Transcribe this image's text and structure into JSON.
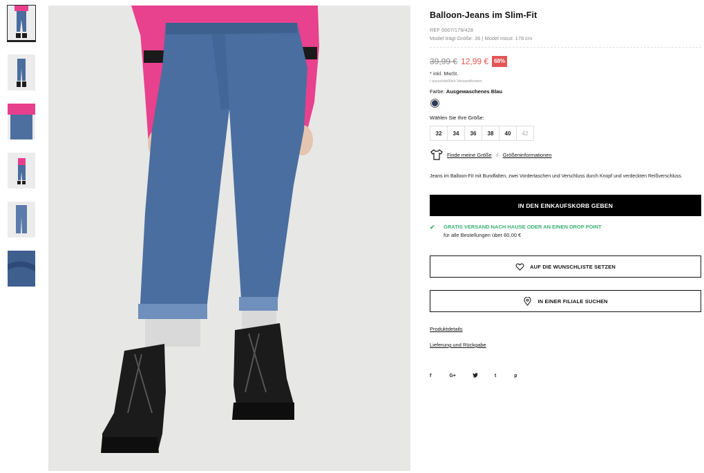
{
  "product": {
    "title": "Balloon-Jeans im Slim-Fit",
    "ref": "REF 0007/179/428",
    "model_info": "Model trägt Größe: 36 | Model misst: 178 cm",
    "old_price": "39,99 €",
    "new_price": "12,99 €",
    "discount": "68%",
    "tax_note": "* inkl. MwSt.",
    "shipping_note": "/ ausschließlich Versandkosten",
    "color_label": "Farbe:",
    "color_value": "Ausgewaschenes Blau",
    "size_label": "Wählen Sie Ihre Größe:",
    "sizes": [
      "32",
      "34",
      "36",
      "38",
      "40",
      "42"
    ],
    "find_size_link": "Finde meine Größe",
    "size_info_link": "Größeninformationen",
    "size_link_separator": "/",
    "description": "Jeans im Balloon-Fit mit Bundfalten, zwei Vordertaschen und Verschluss durch Knopf und verdeckten Reißverschluss.",
    "add_to_cart": "IN DEN EINKAUFSKORB GEBEN",
    "free_shipping_title": "GRATIS VERSAND NACH HAUSE ODER AN EINEN DROP POINT",
    "free_shipping_sub": "für alle Bestellungen über 60,00 €",
    "wishlist": "AUF DIE WUNSCHLISTE SETZEN",
    "find_store": "IN EINER FILIALE SUCHEN",
    "product_details": "Produktdetails",
    "delivery_returns": "Lieferung und Rückgabe"
  },
  "social": {
    "facebook": "f",
    "google_plus": "G+",
    "twitter": "🐦",
    "tumblr": "t",
    "pinterest": "p"
  },
  "colors": {
    "accent_sale": "#e25555",
    "free_shipping": "#3bb273",
    "swatch": "#2d3a57",
    "button_bg": "#000000"
  },
  "icons": [
    "tshirt-icon",
    "heart-icon",
    "location-pin-icon",
    "check-icon"
  ]
}
